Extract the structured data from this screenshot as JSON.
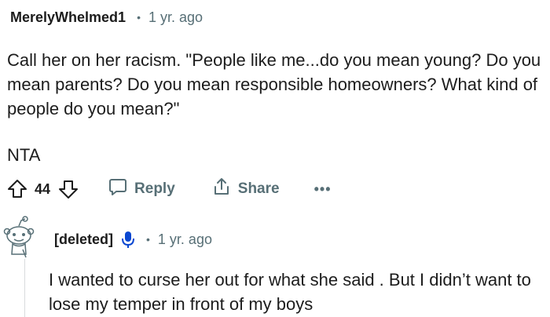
{
  "comment": {
    "username": "MerelyWhelmed1",
    "separator": "•",
    "timestamp": "1 yr. ago",
    "paragraphs": [
      "Call her on her racism. \"People like me...do you mean young? Do you mean parents? Do you mean responsible homeowners? What kind of people do you mean?\"",
      "NTA"
    ],
    "votes": "44",
    "reply_label": "Reply",
    "share_label": "Share",
    "more_label": "•••"
  },
  "reply": {
    "username": "[deleted]",
    "separator": "•",
    "timestamp": "1 yr. ago",
    "text": "I wanted to curse her out for what she said . But I didn’t want to lose my temper in front of my boys"
  },
  "colors": {
    "text": "#1c1c1c",
    "muted": "#576f76",
    "accent_mic": "#0a47d1",
    "thread_line": "#d8dbdd"
  },
  "icons": {
    "upvote": "upvote-icon",
    "downvote": "downvote-icon",
    "reply": "comment-bubble-icon",
    "share": "share-icon",
    "mic": "microphone-icon",
    "avatar": "snoo-avatar-icon"
  }
}
